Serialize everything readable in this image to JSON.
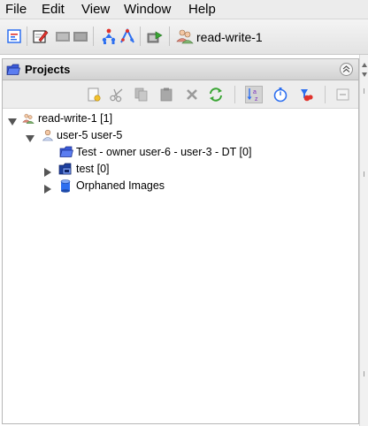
{
  "menu": {
    "items": [
      {
        "label": "File"
      },
      {
        "label": "Edit"
      },
      {
        "label": "View"
      },
      {
        "label": "Window"
      },
      {
        "label": "Help"
      }
    ]
  },
  "toolbar": {
    "current_user": "read-write-1",
    "icons": [
      "hierarchy-icon",
      "edit-icon",
      "panel-icon",
      "panel-icon",
      "group-icon",
      "chart-icon",
      "import-icon",
      "users-icon"
    ]
  },
  "projects": {
    "title": "Projects",
    "tree": {
      "root_label": "read-write-1 [1]",
      "user_label": "user-5 user-5",
      "project_label": "Test - owner user-6 - user-3 - DT [0]",
      "dataset_label": "test [0]",
      "orphaned_label": "Orphaned Images"
    },
    "tools": [
      "new-icon",
      "cut-icon",
      "copy-icon",
      "paste-icon",
      "delete-icon",
      "refresh-icon",
      "sort-icon",
      "timer-icon",
      "filter-icon",
      "collapse-icon"
    ]
  },
  "colors": {
    "accent": "#2d6ff0",
    "folder": "#3a5ad9",
    "header": "#d9d9d9"
  }
}
